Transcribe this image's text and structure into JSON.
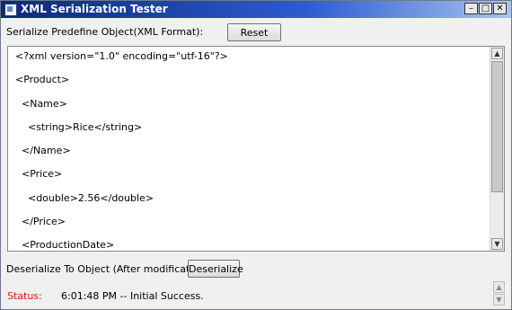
{
  "window": {
    "title": "XML Serialization Tester",
    "min_glyph": "–",
    "max_glyph": "□",
    "close_glyph": "✕"
  },
  "serialize": {
    "label": "Serialize Predefine Object(XML Format):",
    "reset_label": "Reset"
  },
  "xml_text": {
    "lines": [
      "<?xml version=\"1.0\" encoding=\"utf-16\"?>",
      "<Product>",
      "  <Name>",
      "    <string>Rice</string>",
      "  </Name>",
      "  <Price>",
      "    <double>2.56</double>",
      "  </Price>",
      "  <ProductionDate>"
    ]
  },
  "deserialize": {
    "label": "Deserialize To Object (After modification)",
    "button_label": "Deserialize"
  },
  "status": {
    "label": "Status:",
    "text": "6:01:48 PM -- Initial Success.",
    "label_color": "#e01a1a"
  },
  "icons": {
    "up": "▲",
    "down": "▼"
  }
}
